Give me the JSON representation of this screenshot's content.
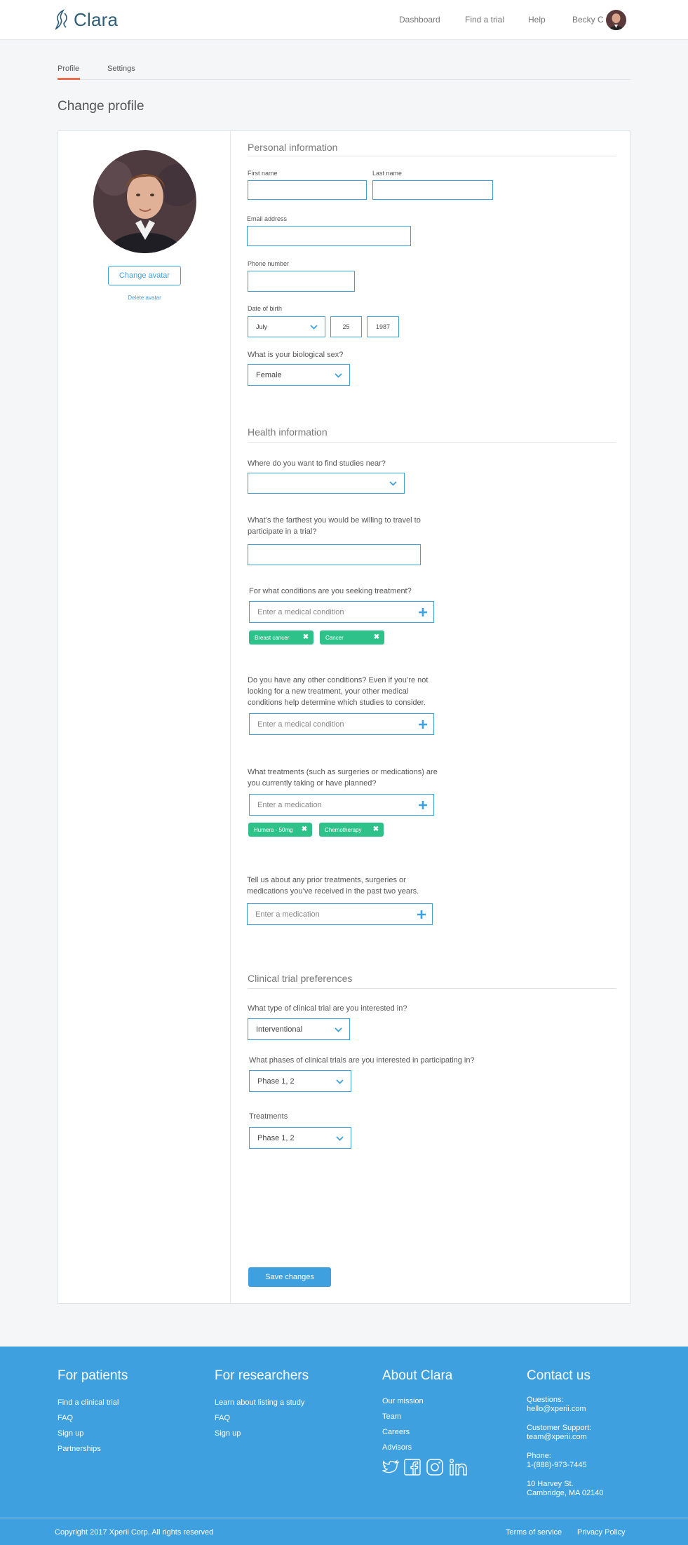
{
  "header": {
    "brand": "Clara",
    "nav": [
      "Dashboard",
      "Find a trial",
      "Help"
    ],
    "user_name": "Becky C"
  },
  "tabs": [
    {
      "label": "Profile",
      "active": true
    },
    {
      "label": "Settings",
      "active": false
    }
  ],
  "page_title": "Change profile",
  "avatar": {
    "change_label": "Change avatar",
    "delete_label": "Delete avatar"
  },
  "personal": {
    "title": "Personal information",
    "first_name_label": "First name",
    "first_name_value": "",
    "last_name_label": "Last name",
    "last_name_value": "",
    "email_label": "Email address",
    "email_value": "",
    "phone_label": "Phone number",
    "phone_value": "",
    "dob_label": "Date of birth",
    "dob_month": "July",
    "dob_day": "25",
    "dob_year": "1987",
    "sex_question": "What is your biological sex?",
    "sex_value": "Female"
  },
  "health": {
    "title": "Health information",
    "location_question": "Where do you want to find studies near?",
    "location_value": "",
    "travel_question_line1": "What’s the farthest you would be willing to travel to",
    "travel_question_line2": "participate in a trial?",
    "travel_value": "",
    "conditions_question": "For what conditions are you seeking treatment?",
    "conditions_placeholder": "Enter a medical condition",
    "conditions_tags": [
      "Breast cancer",
      "Cancer"
    ],
    "other_question_line1": "Do you have any other conditions? Even if you’re not",
    "other_question_line2": "looking for a new treatment, your other medical",
    "other_question_line3": "conditions help determine which studies to consider.",
    "other_placeholder": "Enter a medical condition",
    "treatments_question_line1": "What treatments (such as surgeries or medications) are",
    "treatments_question_line2": "you currently taking or have planned?",
    "treatments_placeholder": "Enter a medication",
    "treatments_tags": [
      "Humera - 50mg",
      "Chemotherapy"
    ],
    "prior_question_line1": "Tell us about any prior treatments, surgeries or",
    "prior_question_line2": "medications you’ve received in the past two years.",
    "prior_placeholder": "Enter a medication"
  },
  "preferences": {
    "title": "Clinical trial preferences",
    "type_question": "What type of clinical trial are you interested in?",
    "type_value": "Interventional",
    "phases_question": "What phases of clinical trials are you interested in participating in?",
    "phases_value": "Phase 1, 2",
    "treatments_label": "Treatments",
    "treatments_value": "Phase 1, 2"
  },
  "save_label": "Save changes",
  "footer": {
    "patients": {
      "title": "For patients",
      "links": [
        "Find a clinical trial",
        "FAQ",
        "Sign up",
        "Partnerships"
      ]
    },
    "researchers": {
      "title": "For researchers",
      "links": [
        "Learn about listing a study",
        "FAQ",
        "Sign up"
      ]
    },
    "about": {
      "title": "About Clara",
      "links": [
        "Our mission",
        "Team",
        "Careers",
        "Advisors"
      ]
    },
    "contact": {
      "title": "Contact us",
      "questions_label": "Questions:",
      "questions_email": "hello@xperii.com",
      "support_label": "Customer Support:",
      "support_email": "team@xperii.com",
      "phone_label": "Phone:",
      "phone": "1-(888)-973-7445",
      "address_line1": "10 Harvey St.",
      "address_line2": "Cambridge, MA 02140"
    },
    "copyright": "Copyright 2017 Xperii Corp. All rights reserved",
    "terms": "Terms of service",
    "privacy": "Privacy Policy",
    "social_icons": [
      "twitter-icon",
      "facebook-icon",
      "instagram-icon",
      "linkedin-icon"
    ]
  },
  "colors": {
    "accent": "#3ea0df",
    "tag": "#2ec28a",
    "tab_active": "#ea6d4e",
    "footer_bg": "#3ea0df"
  }
}
